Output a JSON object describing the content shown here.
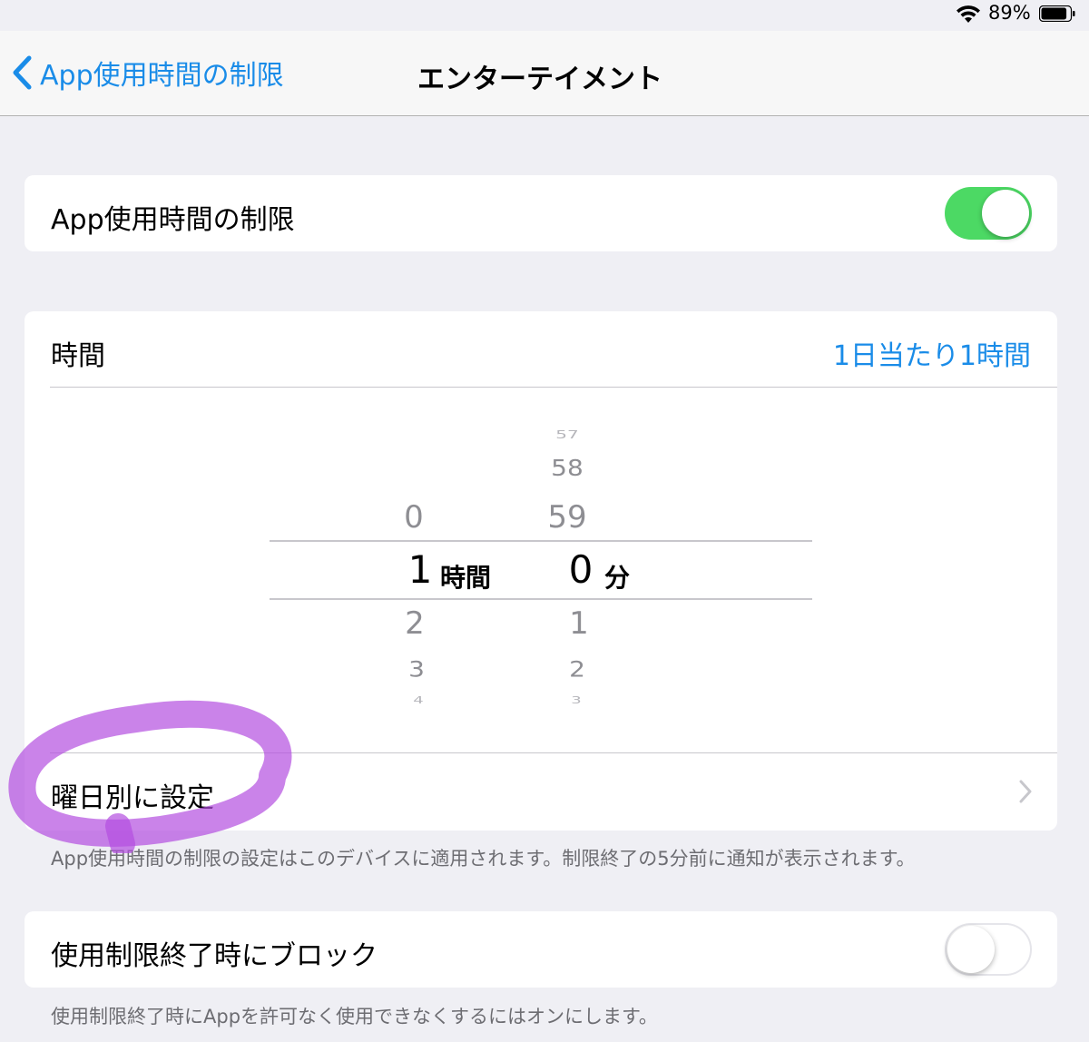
{
  "status_bar": {
    "battery_percent": "89%",
    "battery_level": 0.89,
    "wifi_icon": "wifi-icon",
    "battery_icon": "battery-icon"
  },
  "nav": {
    "back_label": "App使用時間の制限",
    "title": "エンターテイメント",
    "back_icon": "chevron-left-icon"
  },
  "limit_toggle": {
    "label": "App使用時間の制限",
    "on": true
  },
  "time_section": {
    "label": "時間",
    "value": "1日当たり1時間",
    "picker": {
      "hours": {
        "above": [
          "0"
        ],
        "selected": "1",
        "below": [
          "2",
          "3",
          "4"
        ],
        "unit": "時間"
      },
      "minutes": {
        "above": [
          "57",
          "58",
          "59"
        ],
        "selected": "0",
        "below": [
          "1",
          "2",
          "3"
        ],
        "unit": "分"
      }
    },
    "by_day_label": "曜日別に設定"
  },
  "footnote_1": "App使用時間の制限の設定はこのデバイスに適用されます。制限終了の5分前に通知が表示されます。",
  "block_toggle": {
    "label": "使用制限終了時にブロック",
    "on": false
  },
  "footnote_2": "使用制限終了時にAppを許可なく使用できなくするにはオンにします。",
  "colors": {
    "accent": "#1a8ce8",
    "toggle_on": "#4cd964",
    "highlight": "#b44fe0",
    "background": "#efeff4"
  }
}
